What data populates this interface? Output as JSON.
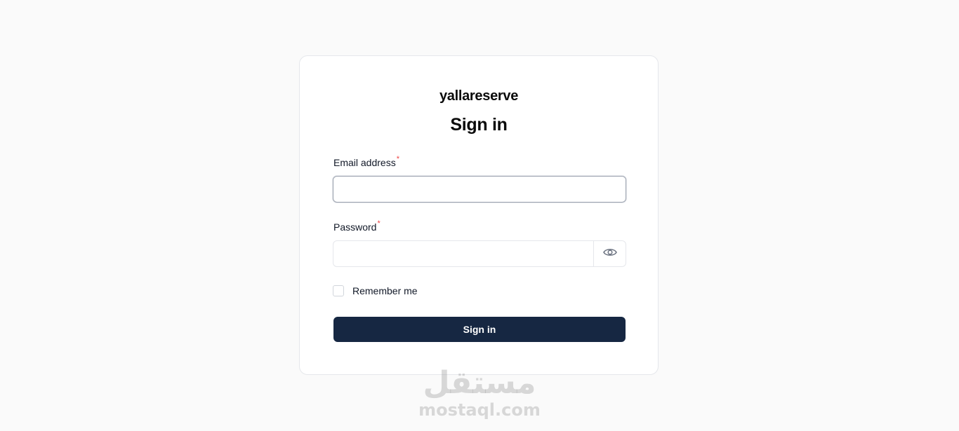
{
  "brand": "yallareserve",
  "title": "Sign in",
  "form": {
    "email_label": "Email address",
    "email_required_mark": "*",
    "email_value": "",
    "email_placeholder": "",
    "password_label": "Password",
    "password_required_mark": "*",
    "password_value": "",
    "password_placeholder": "",
    "password_toggle_icon": "eye-icon",
    "remember_label": "Remember me",
    "remember_checked": false,
    "submit_label": "Sign in"
  },
  "watermark": {
    "arabic": "مستقل",
    "latin": "mostaql.com"
  },
  "colors": {
    "background": "#fafafa",
    "card": "#ffffff",
    "primary_button": "#162742",
    "required": "#ef4444"
  }
}
